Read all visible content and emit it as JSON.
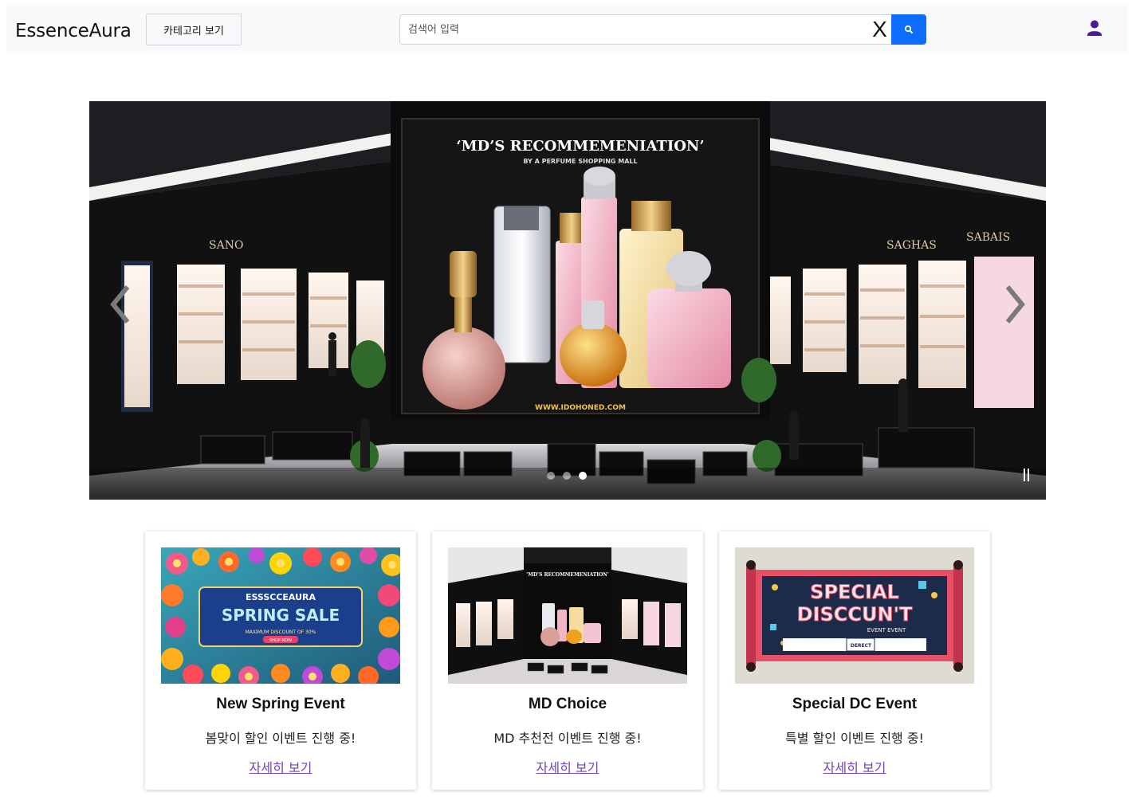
{
  "header": {
    "brand": "EssenceAura",
    "category_button": "카테고리 보기",
    "search": {
      "placeholder": "검색어 입력",
      "value": "",
      "clear_label": "X"
    }
  },
  "carousel": {
    "slide_heading": "‘MD’S RECOMMEMENIATION’",
    "slide_subheading": "BY A PERFUME SHOPPING MALL",
    "slide_url": "WWW.IDOHONED.COM",
    "store_signs": [
      "SANO",
      "SAGHAS",
      "SABAIS"
    ],
    "slide_count": 3,
    "active_slide": 3
  },
  "cards": [
    {
      "title": "New Spring Event",
      "description": "봄맞이 할인 이벤트 진행 중!",
      "link": "자세히 보기",
      "banner": {
        "line1": "ESSSCCEAURA",
        "line2": "SPRING SALE",
        "line3": "MAXIMUM DISCOUNT OF 30%",
        "line4": "SHOP NOW"
      }
    },
    {
      "title": "MD Choice",
      "description": "MD 추천전 이벤트 진행 중!",
      "link": "자세히 보기",
      "banner": {
        "line1": "‘MD’S RECOMMEMENIATION’"
      }
    },
    {
      "title": "Special DC Event",
      "description": "특별 할인 이벤트 진행 중!",
      "link": "자세히 보기",
      "banner": {
        "line1": "SPECIAL",
        "line2": "DISCCUN'T",
        "line3": "EVENT EVENT",
        "line4": "DERECT"
      }
    }
  ],
  "colors": {
    "primary": "#0d6efd",
    "link": "#6f42c1",
    "header_bg": "#f8f9fa",
    "user_icon": "#4b1c8f"
  }
}
